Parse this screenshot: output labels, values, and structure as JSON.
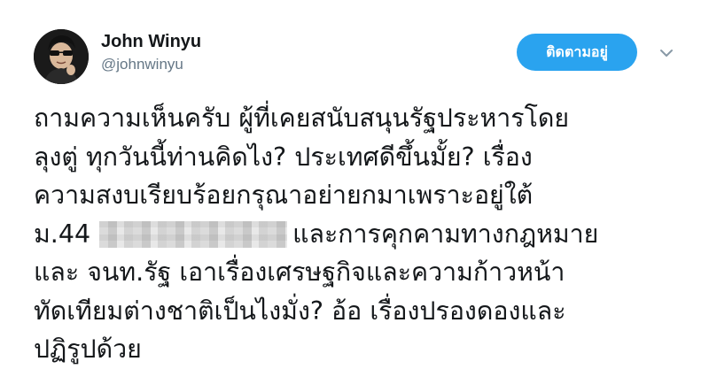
{
  "user": {
    "name": "John Winyu",
    "handle": "@johnwinyu"
  },
  "follow_button": {
    "label": "ติดตามอยู่"
  },
  "tweet": {
    "line1": "ถามความเห็นครับ ผู้ที่เคยสนับสนุนรัฐประหารโดย",
    "line2": "ลุงตู่ ทุกวันนี้ท่านคิดไง? ประเทศดีขึ้นมั้ย? เรื่อง",
    "line3": "ความสงบเรียบร้อยกรุณาอย่ายกมาเพราะอยู่ใต้",
    "line4_before": "ม.44",
    "line4_after": "และการคุกคามทางกฎหมาย",
    "line5": "และ จนท.รัฐ เอาเรื่องเศรษฐกิจและความก้าวหน้า",
    "line6": "ทัดเทียมต่างชาติเป็นไงมั่ง? อ้อ เรื่องปรองดองและ",
    "line7": "ปฏิรูปด้วย"
  },
  "colors": {
    "accent": "#2aa3ef",
    "text": "#14171a",
    "muted": "#657786"
  },
  "icons": {
    "avatar": "profile-photo",
    "menu": "chevron-down-icon"
  }
}
